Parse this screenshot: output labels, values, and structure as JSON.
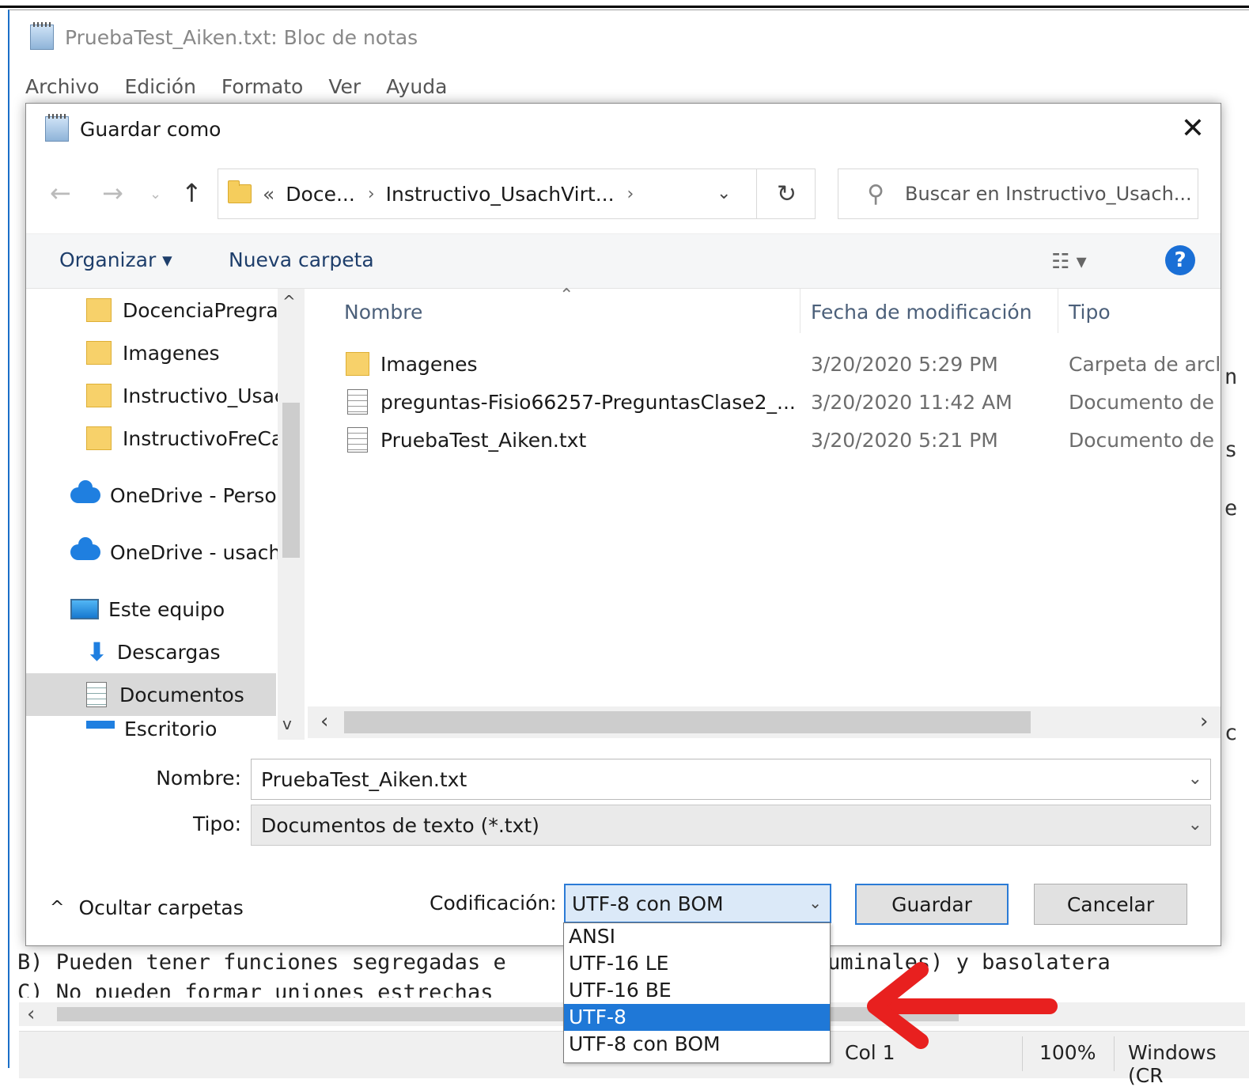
{
  "notepad": {
    "title": "PruebaTest_Aiken.txt: Bloc de notas",
    "menu": [
      "Archivo",
      "Edición",
      "Formato",
      "Ver",
      "Ayuda"
    ],
    "text_line1": "B) Pueden tener funciones segregadas e                   les (luminales) y basolatera",
    "text_line2": "C) No pueden formar uniones estrechas",
    "status": {
      "col": "Col 1",
      "zoom": "100%",
      "encoding": "Windows (CR"
    }
  },
  "dialog": {
    "title": "Guardar como",
    "address": {
      "prefix": "«",
      "crumb1": "Doce...",
      "crumb2": "Instructivo_UsachVirt..."
    },
    "search_placeholder": "Buscar en Instructivo_Usach...",
    "toolbar": {
      "organize": "Organizar ▾",
      "new_folder": "Nueva carpeta"
    },
    "nav_items": [
      "DocenciaPregrad",
      "Imagenes",
      "Instructivo_Usac",
      "InstructivoFreCa",
      "OneDrive - Persor",
      "OneDrive - usach.",
      "Este equipo",
      "Descargas",
      "Documentos",
      "Escritorio"
    ],
    "columns": {
      "name": "Nombre",
      "date": "Fecha de modificación",
      "type": "Tipo"
    },
    "files": [
      {
        "name": "Imagenes",
        "date": "3/20/2020 5:29 PM",
        "type": "Carpeta de archivos"
      },
      {
        "name": "preguntas-Fisio66257-PreguntasClase2_...",
        "date": "3/20/2020 11:42 AM",
        "type": "Documento de texto"
      },
      {
        "name": "PruebaTest_Aiken.txt",
        "date": "3/20/2020 5:21 PM",
        "type": "Documento de texto"
      }
    ],
    "filename_label": "Nombre:",
    "filename_value": "PruebaTest_Aiken.txt",
    "filetype_label": "Tipo:",
    "filetype_value": "Documentos de texto (*.txt)",
    "hide_folders": "Ocultar carpetas",
    "encoding_label": "Codificación:",
    "encoding_value": "UTF-8 con BOM",
    "save": "Guardar",
    "cancel": "Cancelar"
  },
  "encoding_options": [
    "ANSI",
    "UTF-16 LE",
    "UTF-16 BE",
    "UTF-8",
    "UTF-8 con BOM"
  ],
  "encoding_highlighted": "UTF-8",
  "colors": {
    "accent": "#1f78d7",
    "arrow": "#e8201f",
    "folder": "#f7d16a"
  }
}
